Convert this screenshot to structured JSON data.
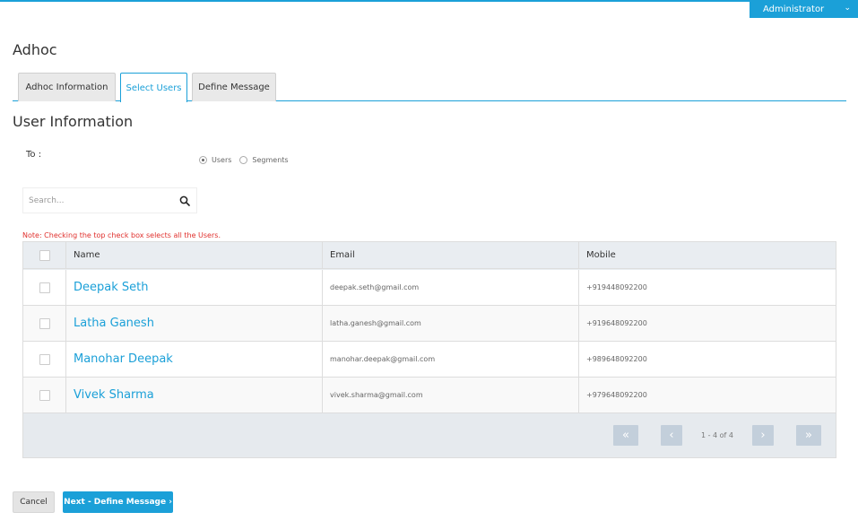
{
  "header": {
    "user_menu_label": "Administrator",
    "user_menu_icon": "chevron-down-icon",
    "accent_color": "#1ba0d8"
  },
  "page": {
    "title": "Adhoc"
  },
  "tabs": [
    {
      "label": "Adhoc Information",
      "active": false
    },
    {
      "label": "Select Users",
      "active": true
    },
    {
      "label": "Define Message",
      "active": false
    }
  ],
  "section": {
    "title": "User Information",
    "to_label": "To :",
    "recipient_options": [
      {
        "label": "Users",
        "selected": true
      },
      {
        "label": "Segments",
        "selected": false
      }
    ]
  },
  "search": {
    "placeholder": "Search...",
    "value": "",
    "icon": "search-icon"
  },
  "note": "Note: Checking the top check box selects all the Users.",
  "note_color": "#e0312e",
  "table": {
    "columns": [
      "Name",
      "Email",
      "Mobile"
    ],
    "rows": [
      {
        "name": "Deepak Seth",
        "email": "deepak.seth@gmail.com",
        "mobile": "+919448092200"
      },
      {
        "name": "Latha Ganesh",
        "email": "latha.ganesh@gmail.com",
        "mobile": "+919648092200"
      },
      {
        "name": "Manohar Deepak",
        "email": "manohar.deepak@gmail.com",
        "mobile": "+989648092200"
      },
      {
        "name": "Vivek Sharma",
        "email": "vivek.sharma@gmail.com",
        "mobile": "+979648092200"
      }
    ]
  },
  "pager": {
    "first": "«",
    "prev": "‹",
    "info": "1 - 4 of 4",
    "next": "›",
    "last": "»"
  },
  "footer": {
    "cancel_label": "Cancel",
    "next_label": "Next - Define Message ›"
  }
}
